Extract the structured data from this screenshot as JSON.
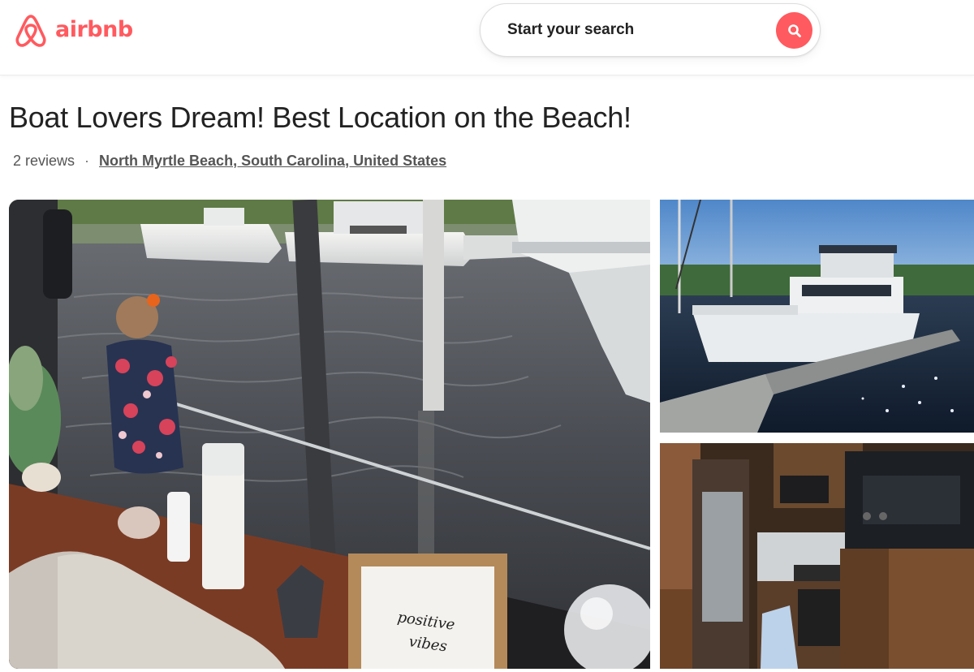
{
  "header": {
    "brand": "airbnb",
    "brand_color": "#ff5a5f",
    "logo_icon": "airbnb-belo-icon",
    "search": {
      "label": "Start your search",
      "button_icon": "search-icon"
    }
  },
  "listing": {
    "title": "Boat Lovers Dream! Best Location on the Beach!",
    "reviews": "2 reviews",
    "separator": "·",
    "location": "North Myrtle Beach, South Carolina, United States"
  },
  "photos": [
    {
      "name": "listing-photo-main",
      "sign_text": "positive vibes"
    },
    {
      "name": "listing-photo-yacht-dock"
    },
    {
      "name": "listing-photo-galley"
    }
  ]
}
